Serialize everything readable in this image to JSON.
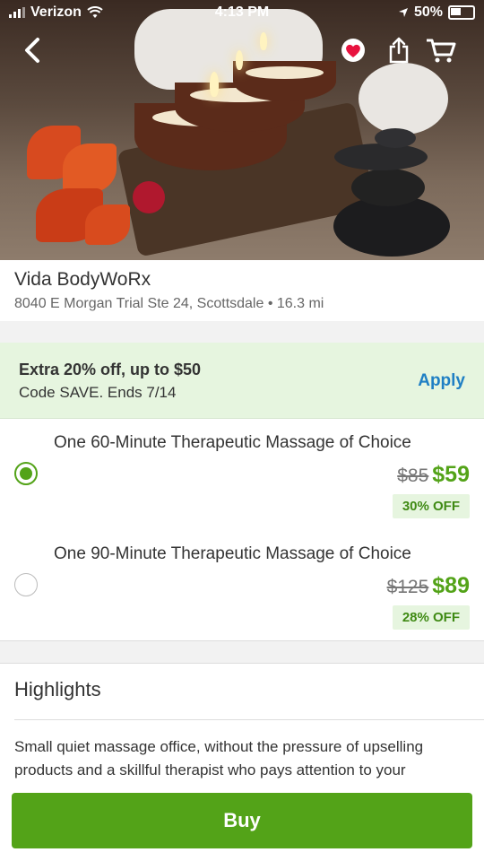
{
  "status_bar": {
    "carrier": "Verizon",
    "time": "4:13 PM",
    "battery": "50%"
  },
  "nav": {
    "back_icon": "chevron-left-icon",
    "favorite_icon": "heart-icon",
    "share_icon": "share-icon",
    "cart_icon": "cart-icon"
  },
  "business": {
    "name": "Vida BodyWoRx",
    "address": "8040 E Morgan Trial Ste 24, Scottsdale • 16.3 mi"
  },
  "promo": {
    "line1": "Extra 20% off, up to $50",
    "line2": "Code SAVE. Ends 7/14",
    "apply_label": "Apply"
  },
  "options": [
    {
      "title": "One 60-Minute Therapeutic Massage of Choice",
      "original_price": "$85",
      "price": "$59",
      "discount": "30% OFF",
      "selected": true
    },
    {
      "title": "One 90-Minute Therapeutic Massage of Choice",
      "original_price": "$125",
      "price": "$89",
      "discount": "28% OFF",
      "selected": false
    }
  ],
  "highlights": {
    "title": "Highlights",
    "text": "Small quiet massage office, without the pressure of upselling products and a skillful therapist who pays attention to your"
  },
  "buy_button": "Buy",
  "colors": {
    "accent_green": "#53a318",
    "promo_bg": "#e6f5df",
    "apply_blue": "#1f7fc4",
    "heart_red": "#e8123f"
  }
}
